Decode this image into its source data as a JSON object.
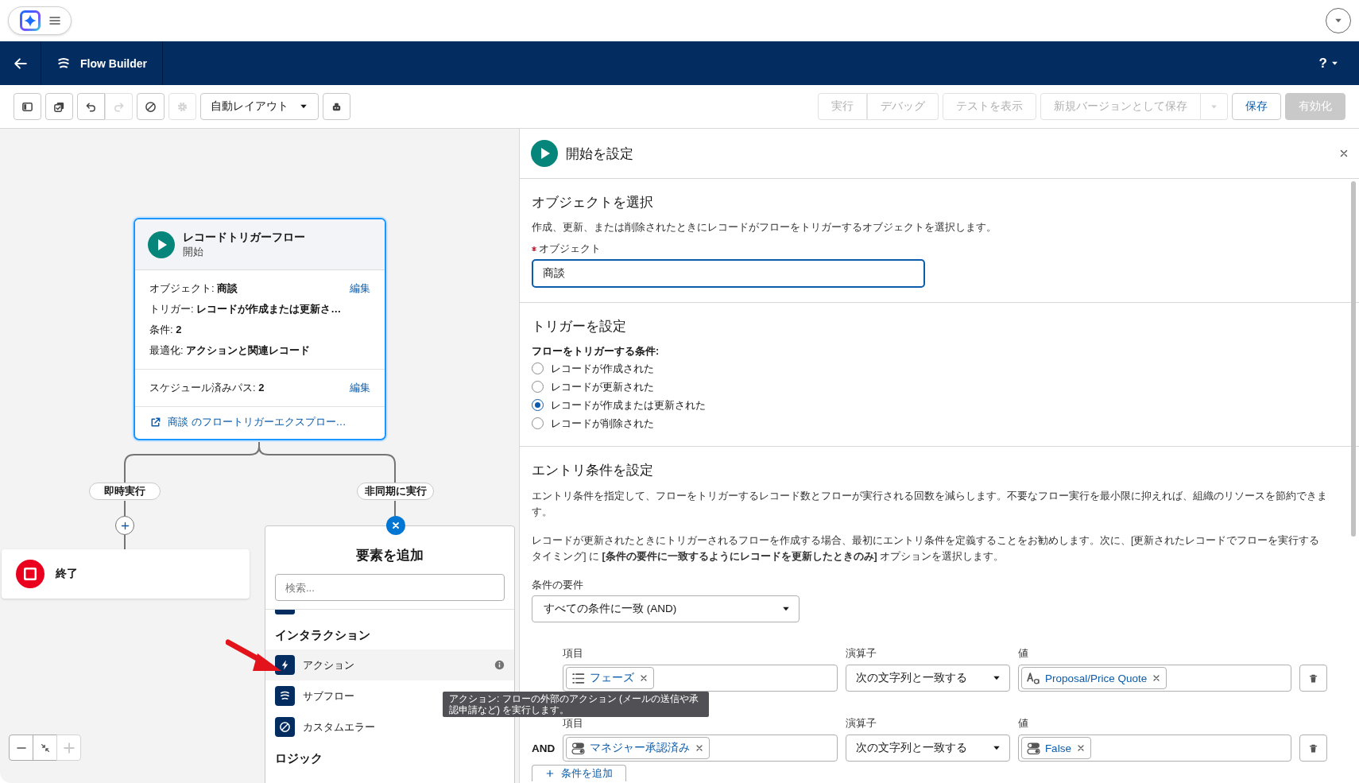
{
  "header": {
    "app_title": "Flow Builder",
    "help_label": "?"
  },
  "toolbar": {
    "icon_buttons": [
      {
        "kind": "panel",
        "disabled": false
      },
      {
        "kind": "checklist",
        "disabled": false
      },
      {
        "kind": "undo",
        "disabled": false
      },
      {
        "kind": "redo",
        "disabled": true
      },
      {
        "kind": "block",
        "disabled": false
      },
      {
        "kind": "gear",
        "disabled": true
      }
    ],
    "layout_select": "自動レイアウト",
    "after_select": [
      {
        "kind": "robot",
        "disabled": false
      }
    ],
    "actions": [
      {
        "kind": "group-start",
        "label": "実行",
        "disabled": true
      },
      {
        "kind": "group-end",
        "label": "デバッグ",
        "disabled": true
      },
      {
        "kind": "plain",
        "label": "テストを表示",
        "disabled": true
      },
      {
        "kind": "split",
        "label": "新規バージョンとして保存",
        "disabled": true
      },
      {
        "kind": "plain",
        "label": "保存",
        "disabled": false
      },
      {
        "kind": "brand",
        "label": "有効化",
        "disabled": true
      }
    ]
  },
  "canvas": {
    "start_node": {
      "title": "レコードトリガーフロー",
      "subtitle": "開始",
      "details": [
        {
          "text": "オブジェクト: **商談**",
          "edit": "編集"
        },
        {
          "text": "トリガー: **レコードが作成または更新さ…**"
        },
        {
          "text": "条件: **2**"
        },
        {
          "text": "最適化: **アクションと関連レコード**"
        }
      ],
      "schedule": {
        "text": "スケジュール済みパス: **2**",
        "edit": "編集"
      },
      "explorer_link": "商談 のフロートリガーエクスプロー…"
    },
    "paths": [
      {
        "label": "即時実行",
        "kind": "add"
      },
      {
        "label": "非同期に実行",
        "kind": "close"
      }
    ],
    "end_node": {
      "label": "終了"
    },
    "add_element": {
      "title": "要素を追加",
      "search_placeholder": "検索...",
      "sections": [
        {
          "heading": "インタラクション",
          "items": [
            {
              "label": "アクション",
              "selected": true
            },
            {
              "label": "サブフロー",
              "selected": false
            },
            {
              "label": "カスタムエラー",
              "selected": false
            }
          ]
        },
        {
          "heading": "ロジック"
        }
      ]
    },
    "tooltip": "アクション: フローの外部のアクション (メールの送信や承認申請など) を実行します。",
    "zoom_controls": [
      {
        "kind": "zoom-out",
        "disabled": false
      },
      {
        "kind": "fit",
        "disabled": false
      },
      {
        "kind": "zoom-in",
        "disabled": true
      }
    ]
  },
  "panel": {
    "title": "開始を設定",
    "object_section": {
      "heading": "オブジェクトを選択",
      "description": "作成、更新、または削除されたときにレコードがフローをトリガーするオブジェクトを選択します。",
      "field_label": "オブジェクト",
      "required": true,
      "value": "商談"
    },
    "trigger_section": {
      "heading": "トリガーを設定",
      "question": "フローをトリガーする条件:",
      "options": [
        {
          "label": "レコードが作成された",
          "selected": false
        },
        {
          "label": "レコードが更新された",
          "selected": false
        },
        {
          "label": "レコードが作成または更新された",
          "selected": true
        },
        {
          "label": "レコードが削除された",
          "selected": false
        }
      ]
    },
    "entry_section": {
      "heading": "エントリ条件を設定",
      "paragraphs": [
        "エントリ条件を指定して、フローをトリガーするレコード数とフローが実行される回数を減らします。不要なフロー実行を最小限に抑えれば、組織のリソースを節約できます。",
        "レコードが更新されたときにトリガーされるフローを作成する場合、最初にエントリ条件を定義することをお勧めします。次に、[更新されたレコードでフローを実行するタイミング] に **[条件の要件に一致するようにレコードを更新したときのみ]** オプションを選択します。"
      ],
      "requirement_label": "条件の要件",
      "requirement_value": "すべての条件に一致 (AND)",
      "conditions": [
        {
          "field_label": "項目",
          "field": "フェーズ",
          "operator_label": "演算子",
          "operator": "次の文字列と一致する",
          "value_label": "値",
          "value": "Proposal/Price Quote"
        },
        {
          "connector": "AND",
          "field_label": "項目",
          "field": "マネジャー承認済み",
          "operator_label": "演算子",
          "operator": "次の文字列と一致する",
          "value_label": "値",
          "value": "False"
        }
      ],
      "add_condition": "条件を追加"
    }
  }
}
